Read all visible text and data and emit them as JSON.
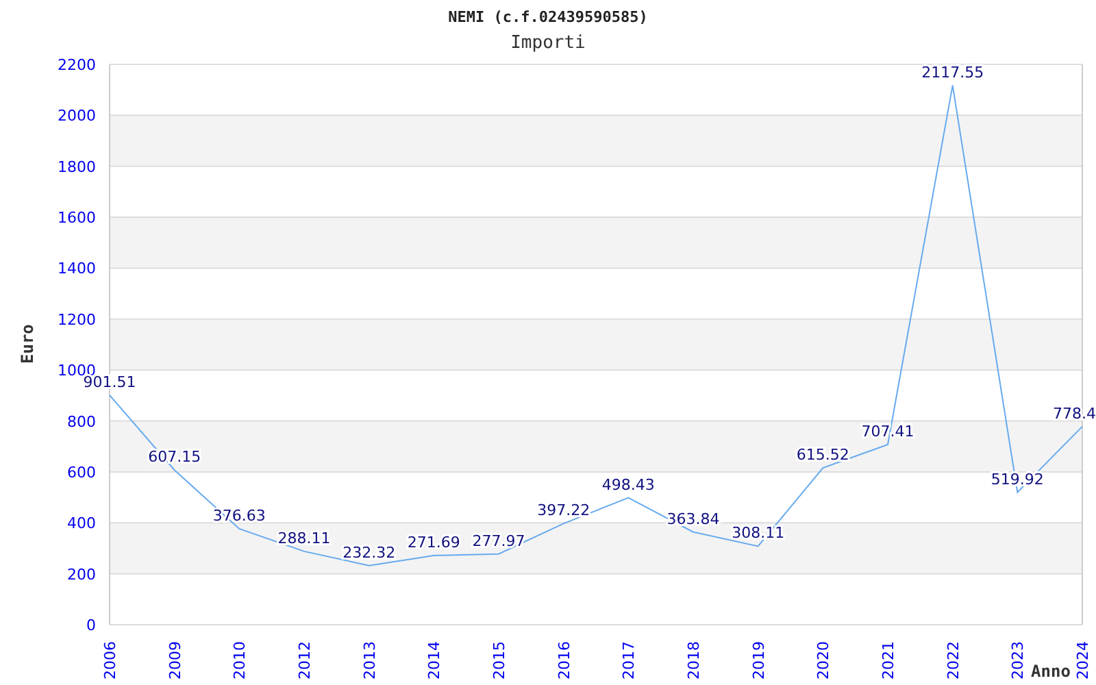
{
  "title": "NEMI (c.f.02439590585)",
  "subtitle": "Importi",
  "chart_data": {
    "type": "line",
    "xlabel": "Anno",
    "ylabel": "Euro",
    "categories": [
      "2006",
      "2009",
      "2010",
      "2012",
      "2013",
      "2014",
      "2015",
      "2016",
      "2017",
      "2018",
      "2019",
      "2020",
      "2021",
      "2022",
      "2023",
      "2024"
    ],
    "grid": true,
    "series": [
      {
        "color": "#66aaee",
        "values": [
          901.51,
          607.15,
          376.63,
          288.11,
          232.32,
          271.69,
          277.97,
          397.22,
          498.43,
          363.84,
          308.11,
          615.52,
          707.41,
          2117.55,
          519.92,
          778.4
        ]
      }
    ],
    "ylim": [
      0,
      2200
    ],
    "yticks": [
      0,
      200,
      400,
      600,
      800,
      1000,
      1200,
      1400,
      1600,
      1800,
      2000,
      2200
    ],
    "value_labels": [
      "901.51",
      "607.15",
      "376.63",
      "288.11",
      "232.32",
      "271.69",
      "277.97",
      "397.22",
      "498.43",
      "363.84",
      "308.11",
      "615.52",
      "707.41",
      "2117.55",
      "519.92",
      "778.4"
    ]
  }
}
